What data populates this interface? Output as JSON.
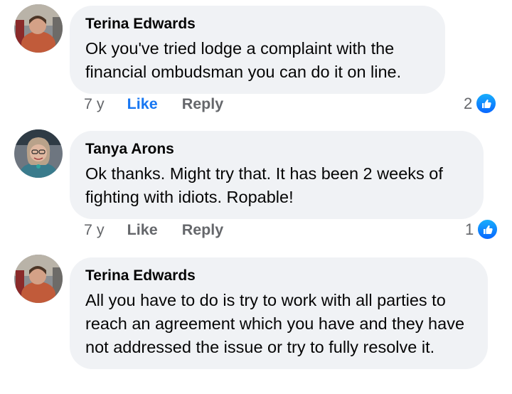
{
  "comments": [
    {
      "author": "Terina Edwards",
      "text": "Ok you've tried lodge a complaint with the financial ombudsman you can do it on line.",
      "time": "7 y",
      "like_label": "Like",
      "reply_label": "Reply",
      "reaction_count": "2",
      "reaction_icon": "thumbs-up-icon",
      "like_active": true
    },
    {
      "author": "Tanya Arons",
      "text": "Ok thanks.  Might try that.  It has been 2 weeks of fighting with idiots.  Ropable!",
      "time": "7 y",
      "like_label": "Like",
      "reply_label": "Reply",
      "reaction_count": "1",
      "reaction_icon": "thumbs-up-icon",
      "like_active": false
    },
    {
      "author": "Terina Edwards",
      "text": "All you have to do is try to work with all parties to reach an agreement which you have and they have not addressed the issue or try to fully resolve it.",
      "time": "",
      "like_label": "",
      "reply_label": "",
      "reaction_count": "",
      "reaction_icon": "",
      "like_active": false
    }
  ],
  "colors": {
    "bubble": "#f0f2f5",
    "like_active": "#1877f2",
    "secondary_text": "#65676b",
    "primary_text": "#050505"
  }
}
